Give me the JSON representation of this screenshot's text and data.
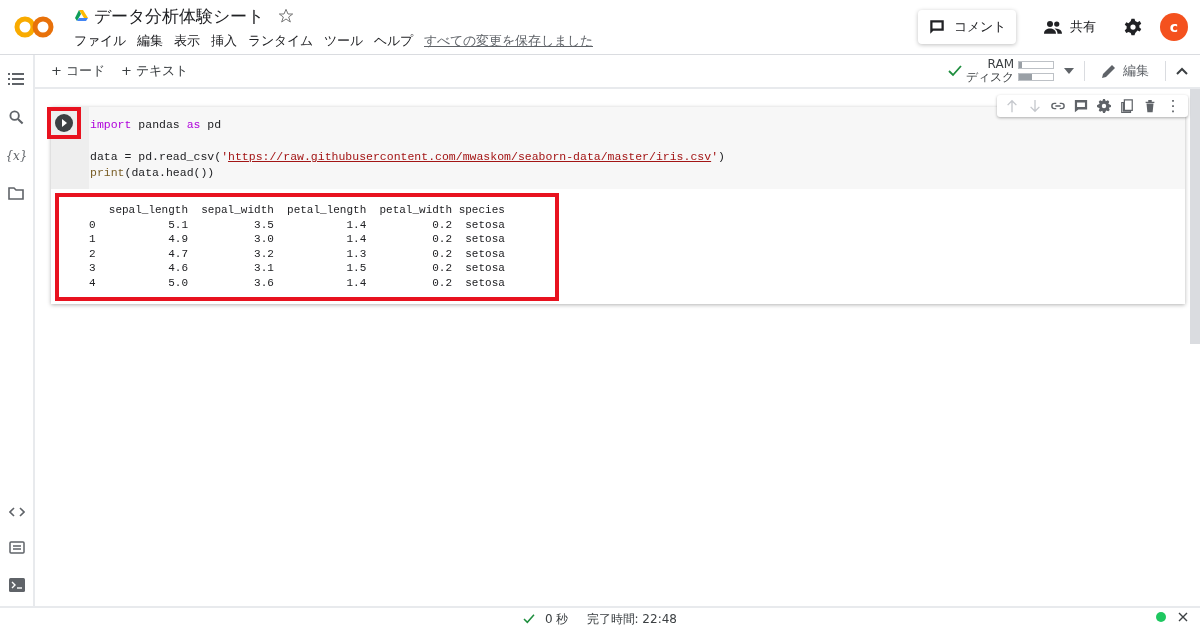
{
  "header": {
    "title": "データ分析体験シート",
    "starred": false,
    "menu": [
      "ファイル",
      "編集",
      "表示",
      "挿入",
      "ランタイム",
      "ツール",
      "ヘルプ"
    ],
    "save_status": "すべての変更を保存しました",
    "comment_button": "コメント",
    "share_button": "共有",
    "avatar": "c"
  },
  "toolbar": {
    "add_buttons": [
      "+ コード",
      "+ テキスト"
    ],
    "resources": [
      {
        "label": "RAM",
        "level": 0.08
      },
      {
        "label": "ディスク",
        "level": 0.38
      }
    ],
    "connected": true,
    "edit_button": "編集"
  },
  "sidebar": [
    {
      "kind": "toc"
    },
    {
      "kind": "search"
    },
    {
      "kind": "variables",
      "glyph": "{x}"
    },
    {
      "kind": "files"
    }
  ],
  "sidebar_bottom": [
    {
      "kind": "code"
    },
    {
      "kind": "snippets"
    },
    {
      "kind": "terminal"
    }
  ],
  "cell": {
    "run_highlighted": true,
    "toolbar": [
      {
        "kind": "up",
        "disabled": true
      },
      {
        "kind": "down",
        "disabled": true
      },
      {
        "kind": "link",
        "disabled": false
      },
      {
        "kind": "comment",
        "disabled": false
      },
      {
        "kind": "settings",
        "disabled": false
      },
      {
        "kind": "mirror",
        "disabled": false
      },
      {
        "kind": "delete",
        "disabled": false
      },
      {
        "kind": "more",
        "disabled": false
      }
    ],
    "code": [
      [
        {
          "tokens": [
            {
              "kind": "keyword",
              "text": "import"
            },
            {
              "kind": "plain",
              "text": " pandas "
            },
            {
              "kind": "keyword",
              "text": "as"
            },
            {
              "kind": "plain",
              "text": " pd"
            }
          ]
        }
      ],
      [
        {
          "tokens": [
            {
              "kind": "plain",
              "text": "data = pd.read_csv("
            },
            {
              "kind": "string",
              "text": "'"
            },
            {
              "kind": "url",
              "text": "https://raw.githubusercontent.com/mwaskom/seaborn-data/master/iris.csv"
            },
            {
              "kind": "string",
              "text": "'"
            },
            {
              "kind": "plain",
              "text": ")"
            }
          ]
        },
        {
          "tokens": [
            {
              "kind": "builtin",
              "text": "print"
            },
            {
              "kind": "plain",
              "text": "(data.head())"
            }
          ]
        }
      ]
    ],
    "output_highlighted": true,
    "output": [
      "   sepal_length  sepal_width  petal_length  petal_width species",
      "0           5.1          3.5           1.4          0.2  setosa",
      "1           4.9          3.0           1.4          0.2  setosa",
      "2           4.7          3.2           1.3          0.2  setosa",
      "3           4.6          3.1           1.5          0.2  setosa",
      "4           5.0          3.6           1.4          0.2  setosa"
    ]
  },
  "status_bar": {
    "success": true,
    "duration": "0 秒",
    "finished": "完了時間: 22:48",
    "connection_dot": {
      "color": "#1ec760"
    }
  }
}
